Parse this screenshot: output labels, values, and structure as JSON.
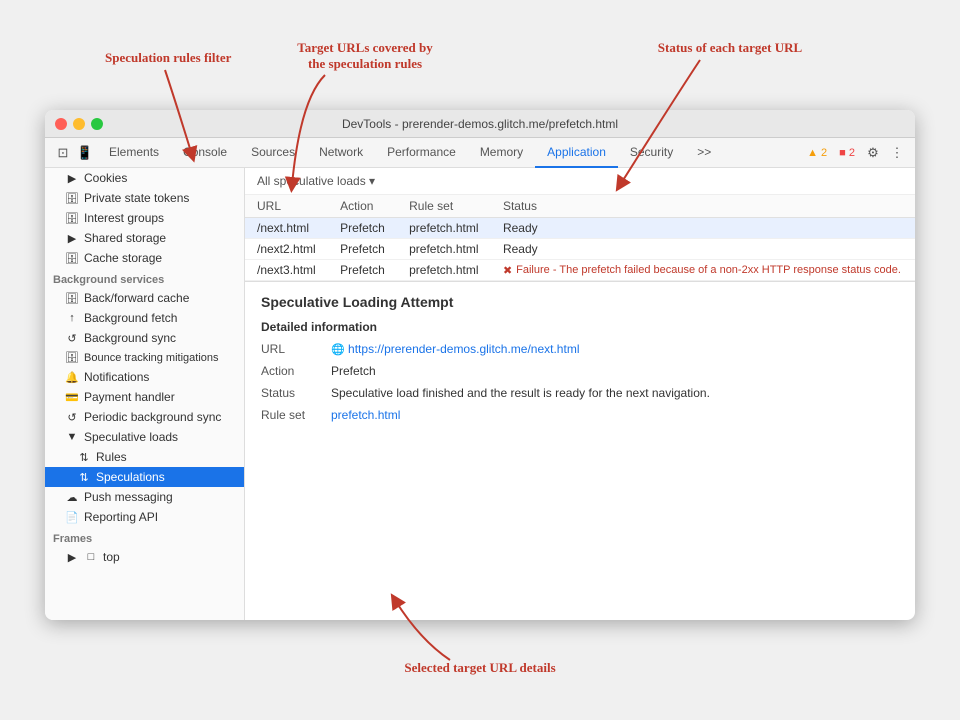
{
  "window": {
    "title": "DevTools - prerender-demos.glitch.me/prefetch.html"
  },
  "annotations": {
    "speculation_filter": "Speculation rules filter",
    "target_urls": "Target URLs covered by\nthe speculation rules",
    "status_label": "Status of each target URL",
    "selected_details": "Selected target URL details"
  },
  "toolbar": {
    "tabs": [
      "Elements",
      "Console",
      "Sources",
      "Network",
      "Performance",
      "Memory",
      "Application",
      "Security",
      ">>"
    ],
    "active_tab": "Application",
    "badges": {
      "warn": "▲ 2",
      "error": "■ 2"
    }
  },
  "sidebar": {
    "sections": {
      "storage": {
        "items": [
          {
            "label": "Cookies",
            "icon": "▶",
            "indent": 1
          },
          {
            "label": "Private state tokens",
            "icon": "🗄",
            "indent": 1
          },
          {
            "label": "Interest groups",
            "icon": "🗄",
            "indent": 1
          },
          {
            "label": "Shared storage",
            "icon": "▶",
            "indent": 1
          },
          {
            "label": "Cache storage",
            "icon": "🗄",
            "indent": 1
          }
        ]
      },
      "bg_services": {
        "title": "Background services",
        "items": [
          {
            "label": "Back/forward cache",
            "icon": "🗄",
            "indent": 1
          },
          {
            "label": "Background fetch",
            "icon": "↑",
            "indent": 1
          },
          {
            "label": "Background sync",
            "icon": "↺",
            "indent": 1
          },
          {
            "label": "Bounce tracking mitigations",
            "icon": "🗄",
            "indent": 1
          },
          {
            "label": "Notifications",
            "icon": "🔔",
            "indent": 1
          },
          {
            "label": "Payment handler",
            "icon": "💳",
            "indent": 1
          },
          {
            "label": "Periodic background sync",
            "icon": "↺",
            "indent": 1
          },
          {
            "label": "Speculative loads",
            "icon": "▼",
            "indent": 1,
            "expanded": true
          },
          {
            "label": "Rules",
            "icon": "↑↓",
            "indent": 2
          },
          {
            "label": "Speculations",
            "icon": "↑↓",
            "indent": 2,
            "active": true
          },
          {
            "label": "Push messaging",
            "icon": "☁",
            "indent": 1
          },
          {
            "label": "Reporting API",
            "icon": "📄",
            "indent": 1
          }
        ]
      },
      "frames": {
        "title": "Frames",
        "items": [
          {
            "label": "top",
            "icon": "▶",
            "indent": 1
          }
        ]
      }
    }
  },
  "main": {
    "all_speculative_loads_label": "All speculative loads ▾",
    "table": {
      "headers": [
        "URL",
        "Action",
        "Rule set",
        "Status"
      ],
      "rows": [
        {
          "url": "/next.html",
          "action": "Prefetch",
          "ruleset": "prefetch.html",
          "status": "Ready",
          "status_type": "ready",
          "selected": true
        },
        {
          "url": "/next2.html",
          "action": "Prefetch",
          "ruleset": "prefetch.html",
          "status": "Ready",
          "status_type": "ready"
        },
        {
          "url": "/next3.html",
          "action": "Prefetch",
          "ruleset": "prefetch.html",
          "status": "✖ Failure - The prefetch failed because of a non-2xx HTTP response status code.",
          "status_type": "error"
        }
      ]
    },
    "detail": {
      "title": "Speculative Loading Attempt",
      "subtitle": "Detailed information",
      "rows": [
        {
          "label": "URL",
          "value": "https://prerender-demos.glitch.me/next.html",
          "type": "link"
        },
        {
          "label": "Action",
          "value": "Prefetch"
        },
        {
          "label": "Status",
          "value": "Speculative load finished and the result is ready for the next navigation."
        },
        {
          "label": "Rule set",
          "value": "prefetch.html",
          "type": "link"
        }
      ]
    }
  }
}
